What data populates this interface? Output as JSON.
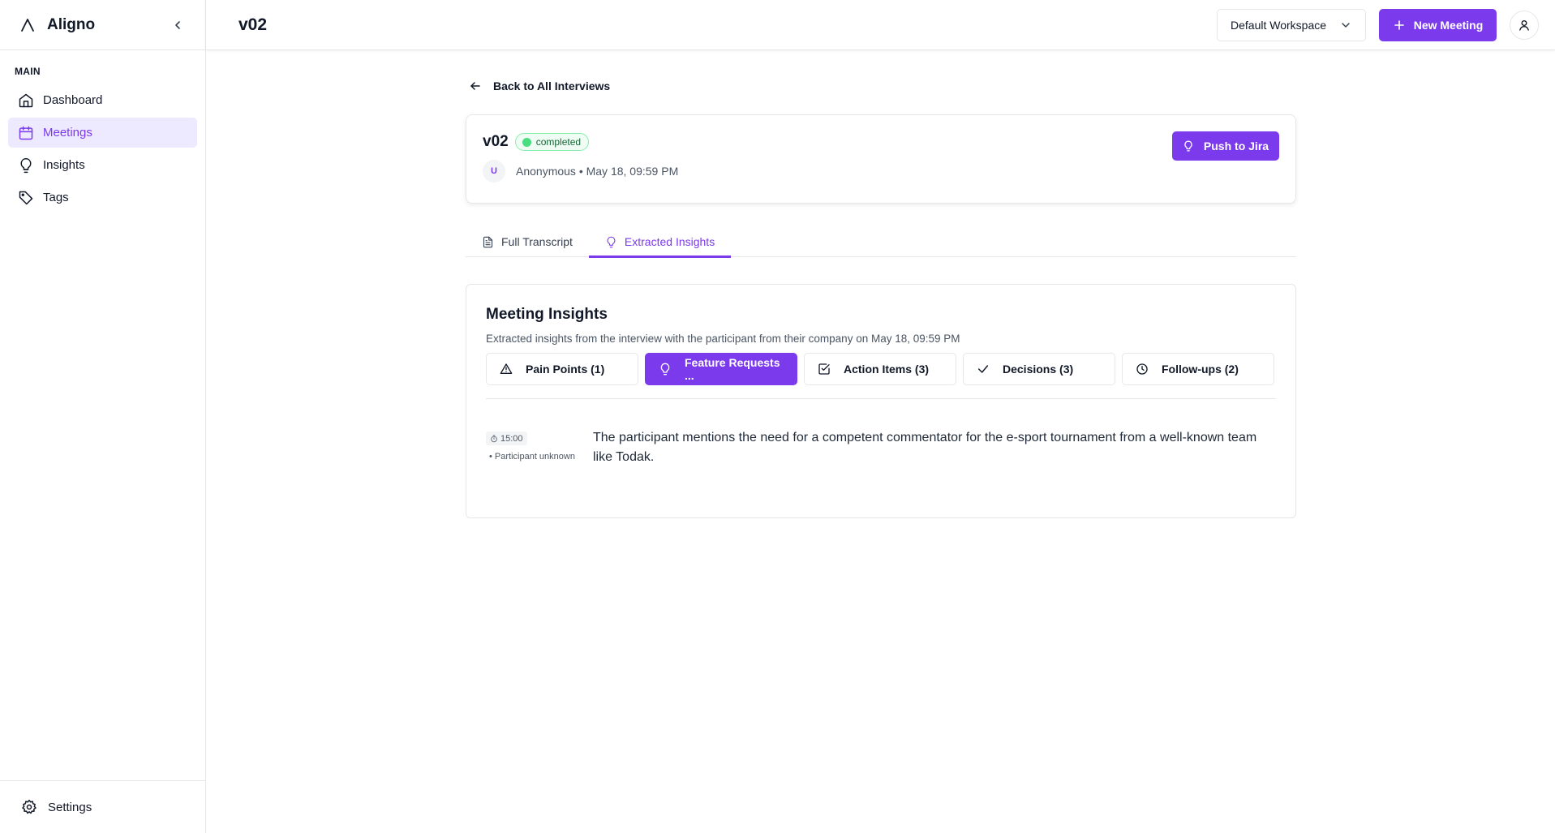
{
  "app": {
    "name": "Aligno",
    "brand_color": "#7c3aed"
  },
  "sidebar": {
    "section_label": "MAIN",
    "items": [
      {
        "label": "Dashboard",
        "icon": "home-icon"
      },
      {
        "label": "Meetings",
        "icon": "calendar-icon",
        "active": true
      },
      {
        "label": "Insights",
        "icon": "lightbulb-icon"
      },
      {
        "label": "Tags",
        "icon": "tag-icon"
      }
    ],
    "footer_label": "Settings"
  },
  "header": {
    "title": "v02",
    "workspace": "Default Workspace",
    "new_meeting_label": "New Meeting"
  },
  "main": {
    "back_label": "Back to All Interviews",
    "meeting": {
      "title": "v02",
      "status": "completed",
      "avatar_initial": "U",
      "meta": "Anonymous • May 18, 09:59 PM",
      "push_label": "Push to Jira"
    },
    "tabs": [
      {
        "label": "Full Transcript",
        "icon": "file-text-icon"
      },
      {
        "label": "Extracted Insights",
        "icon": "lightbulb-icon",
        "active": true
      }
    ],
    "insights": {
      "title": "Meeting Insights",
      "subtitle": "Extracted insights from the interview with the participant from their company on May 18, 09:59 PM",
      "categories": [
        {
          "label": "Pain Points (1)",
          "icon": "alert-triangle-icon"
        },
        {
          "label": "Feature Requests ...",
          "icon": "lightbulb-icon",
          "active": true
        },
        {
          "label": "Action Items (3)",
          "icon": "check-square-icon"
        },
        {
          "label": "Decisions (3)",
          "icon": "check-icon"
        },
        {
          "label": "Follow-ups (2)",
          "icon": "clock-icon"
        }
      ],
      "items": [
        {
          "time": "15:00",
          "participant": "• Participant unknown",
          "text": "The participant mentions the need for a competent commentator for the e-sport tournament from a well-known team like Todak."
        }
      ]
    }
  }
}
